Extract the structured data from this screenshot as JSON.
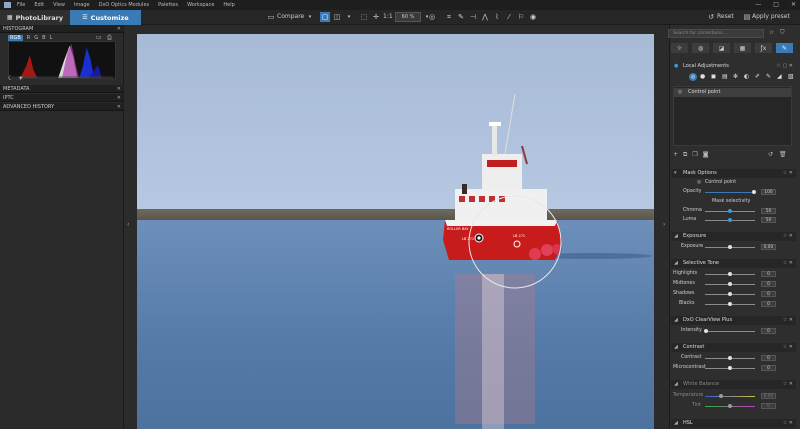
{
  "menu": {
    "items": [
      "File",
      "Edit",
      "View",
      "Image",
      "DxO Optics Modules",
      "Palettes",
      "Workspace",
      "Help"
    ]
  },
  "window": {
    "minimize": "—",
    "maximize": "□",
    "close": "✕"
  },
  "tabs": {
    "photolibrary": "PhotoLibrary",
    "customize": "Customize"
  },
  "toolbar": {
    "compare": "Compare",
    "zoom_one": "1:1",
    "zoom_value": "60 %",
    "reset": "Reset",
    "apply_preset": "Apply preset"
  },
  "left": {
    "histogram": "HISTOGRAM",
    "channels": [
      "RGB",
      "R",
      "G",
      "B",
      "L"
    ],
    "metadata": "METADATA",
    "iptc": "IPTC",
    "advanced_history": "ADVANCED HISTORY"
  },
  "photo": {
    "boat_text_1": "LB 271",
    "boat_text_2": "LB 271",
    "boat_text_3": "ROLLER BAY"
  },
  "right": {
    "search_placeholder": "Search for corrections...",
    "local_adjustments": "Local Adjustments",
    "control_point": "Control point",
    "mask_options": "Mask Options",
    "mask_control_point": "Control point",
    "opacity": "Opacity",
    "opacity_val": "100",
    "mask_selectivity": "Mask selectivity",
    "chroma": "Chroma",
    "chroma_val": "50",
    "luma": "Luma",
    "luma_val": "50",
    "exposure": "Exposure",
    "exposure_label": "Exposure",
    "exposure_val": "0.00",
    "selective_tone": "Selective Tone",
    "highlights": "Highlights",
    "highlights_val": "0",
    "midtones": "Midtones",
    "midtones_val": "0",
    "shadows": "Shadows",
    "shadows_val": "0",
    "blacks": "Blacks",
    "blacks_val": "0",
    "clearview": "DxO ClearView Plus",
    "intensity": "Intensity",
    "intensity_val": "0",
    "contrast": "Contrast",
    "contrast_label": "Contrast",
    "contrast_val": "0",
    "microcontrast": "Microcontrast",
    "microcontrast_val": "0",
    "white_balance": "White Balance",
    "temperature": "Temperature",
    "temperature_val": "0.00",
    "tint": "Tint",
    "tint_val": "0",
    "hsl": "HSL"
  }
}
